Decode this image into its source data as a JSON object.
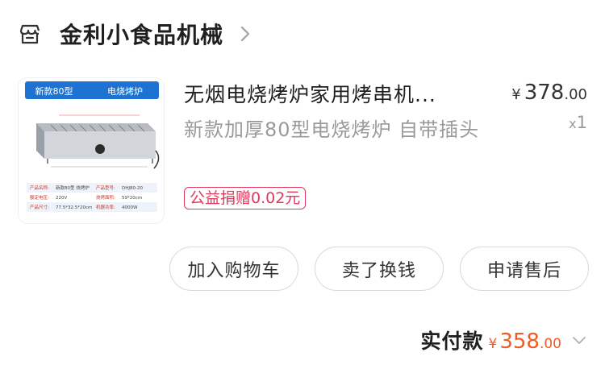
{
  "shop": {
    "name": "金利小食品机械",
    "icon": "shop-icon",
    "arrow": "chevron-right-icon"
  },
  "product": {
    "title": "无烟电烧烤炉家用烤串机...",
    "spec": "新款加厚80型电烧烤炉 自带插头",
    "badge": "公益捐赠0.02元",
    "price_currency": "¥",
    "price_int": "378",
    "price_dec": ".00",
    "qty_x": "x",
    "qty": "1",
    "image": {
      "banner_left": "新款80型",
      "banner_right": "电烧烤炉",
      "banner_color": "#1e73d2",
      "table": [
        [
          "产品名称:",
          "新款80型 烧烤炉",
          "产品型号:",
          "DHJ80-20"
        ],
        [
          "额定电压:",
          "220V",
          "烧烤面积:",
          "59*20cm"
        ],
        [
          "产品尺寸:",
          "77.5*32.5*20cm",
          "机器功率:",
          "4000W"
        ]
      ]
    }
  },
  "actions": {
    "add_to_cart": "加入购物车",
    "resell": "卖了换钱",
    "after_sale": "申请售后"
  },
  "total": {
    "label": "实付款",
    "currency": "¥",
    "int": "358",
    "dec": ".00",
    "accent": "#f05a24"
  },
  "colors": {
    "badge": "#e0385b",
    "muted": "#9a9a9a"
  }
}
